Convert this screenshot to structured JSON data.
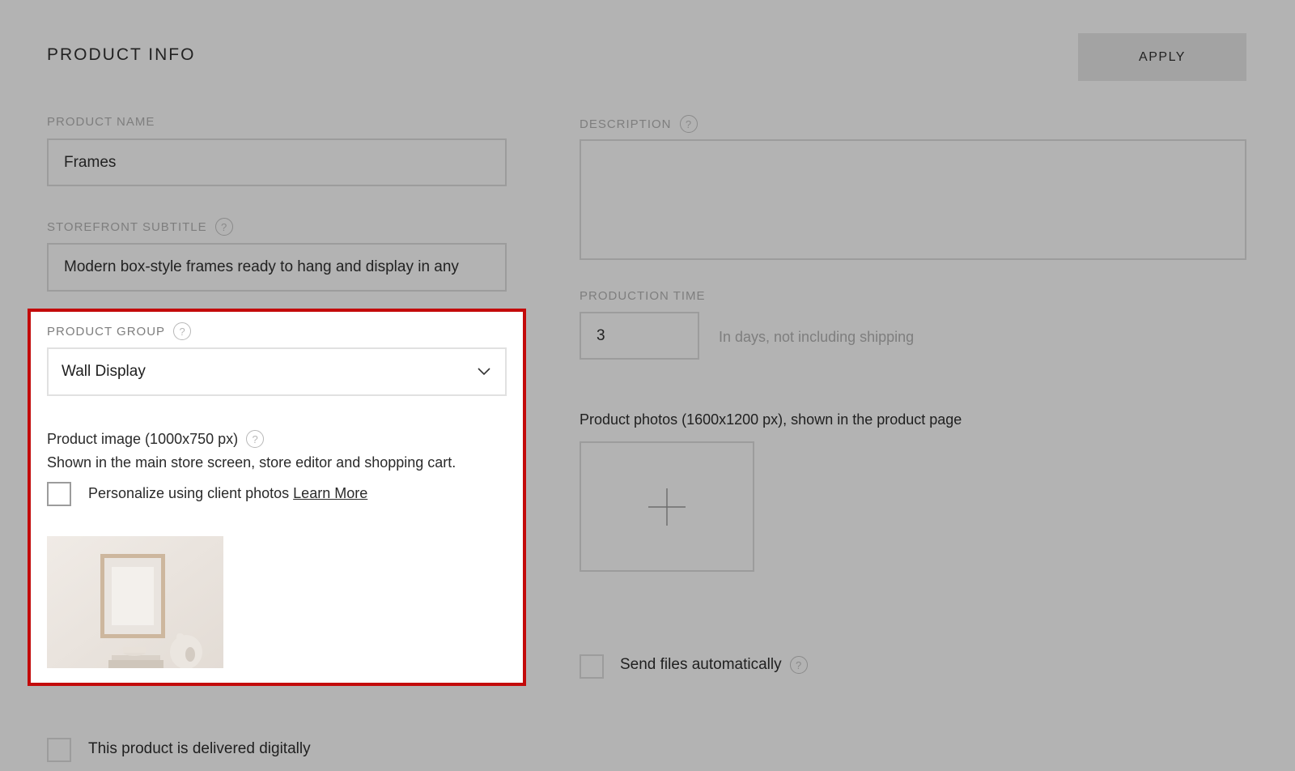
{
  "header": {
    "title": "PRODUCT INFO",
    "apply_label": "APPLY"
  },
  "product_name": {
    "label": "PRODUCT NAME",
    "value": "Frames"
  },
  "storefront_subtitle": {
    "label": "STOREFRONT SUBTITLE",
    "value": "Modern box-style frames ready to hang and display in any"
  },
  "product_group": {
    "label": "PRODUCT GROUP",
    "selected": "Wall Display"
  },
  "product_image": {
    "title": "Product image (1000x750 px)",
    "description": "Shown in the main store screen, store editor and shopping cart.",
    "personalize_label": "Personalize using client photos",
    "learn_more": "Learn More"
  },
  "description": {
    "label": "DESCRIPTION",
    "value": ""
  },
  "production_time": {
    "label": "PRODUCTION TIME",
    "value": "3",
    "hint": "In days, not including shipping"
  },
  "product_photos": {
    "label": "Product photos (1600x1200 px), shown in the product page"
  },
  "send_files": {
    "label": "Send files automatically"
  },
  "delivered_digitally": {
    "label": "This product is delivered digitally"
  },
  "icons": {
    "help": "?",
    "add": "plus-icon",
    "dropdown": "chevron-down-icon"
  },
  "colors": {
    "highlight": "#c30a0a",
    "overlay": "#b3b3b3"
  }
}
